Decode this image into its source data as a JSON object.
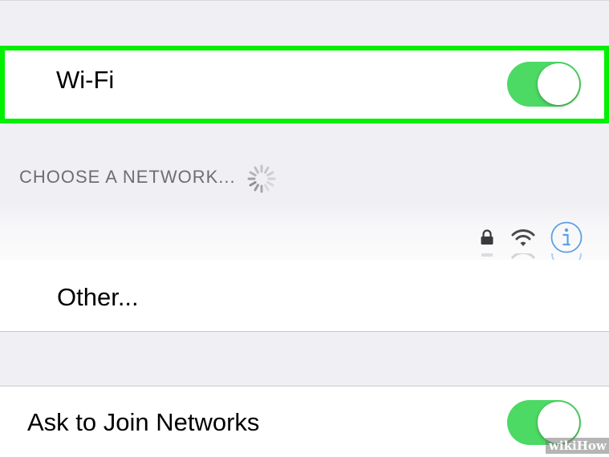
{
  "wifi": {
    "label": "Wi-Fi",
    "enabled": true
  },
  "networks": {
    "header": "CHOOSE A NETWORK...",
    "loading": true,
    "partial_row_icons": [
      "lock-icon",
      "wifi-signal-icon",
      "info-icon"
    ]
  },
  "other": {
    "label": "Other..."
  },
  "ask_to_join": {
    "label": "Ask to Join Networks",
    "enabled": true
  },
  "watermark": {
    "brand_light": "wiki",
    "brand_bold": "How"
  },
  "colors": {
    "toggle_on": "#4cd964",
    "highlight": "#00f000",
    "info_blue": "#5aa0e6",
    "section_text": "#6d6d72",
    "background": "#efeff4"
  }
}
